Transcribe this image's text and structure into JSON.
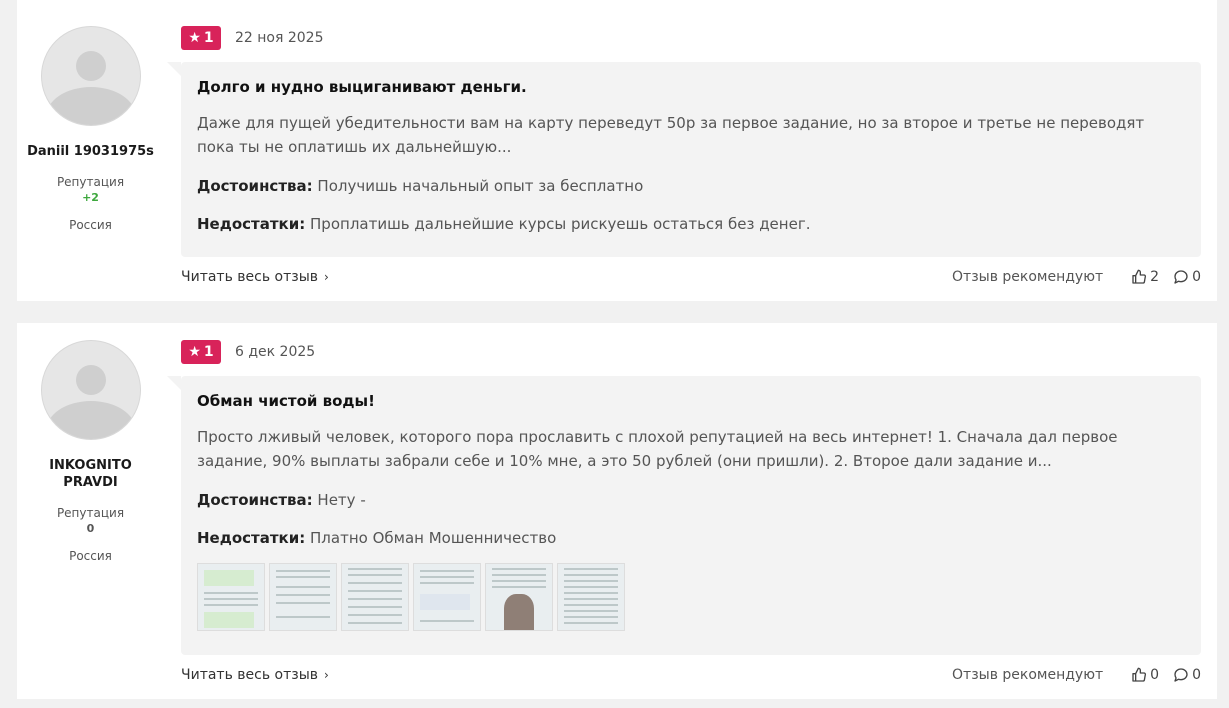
{
  "reviews": [
    {
      "author": {
        "name": "Daniil 19031975s",
        "reputation_label": "Репутация",
        "reputation_value": "+2",
        "country": "Россия"
      },
      "rating": "1",
      "date": "22 ноя 2025",
      "title": "Долго и нудно выциганивают деньги.",
      "excerpt": "Даже для пущей убедительности вам на карту переведут 50р за первое задание, но за второе и третье не переводят пока ты не оплатишь их дальнейшую...",
      "pros_label": "Достоинства:",
      "pros": "Получишь начальный опыт за бесплатно",
      "cons_label": "Недостатки:",
      "cons": "Проплатишь дальнейшие курсы рискуешь остаться без денег.",
      "read_more": "Читать весь отзыв",
      "recommend_label": "Отзыв рекомендуют",
      "likes": "2",
      "comments": "0"
    },
    {
      "author": {
        "name": "INKOGNITO PRAVDI",
        "reputation_label": "Репутация",
        "reputation_value": "0",
        "country": "Россия"
      },
      "rating": "1",
      "date": "6 дек 2025",
      "title": "Обман чистой воды!",
      "excerpt": "Просто лживый человек, которого пора прославить с плохой репутацией на весь интернет! 1. Сначала дал первое задание, 90% выплаты забрали себе и 10% мне, а это 50 рублей (они пришли). 2. Второе дали задание и...",
      "pros_label": "Достоинства:",
      "pros": "Нету -",
      "cons_label": "Недостатки:",
      "cons": "Платно Обман Мошенничество",
      "read_more": "Читать весь отзыв",
      "recommend_label": "Отзыв рекомендуют",
      "likes": "0",
      "comments": "0"
    }
  ],
  "colors": {
    "rating_badge": "#d8235a",
    "reputation_positive": "#3ea83e"
  }
}
